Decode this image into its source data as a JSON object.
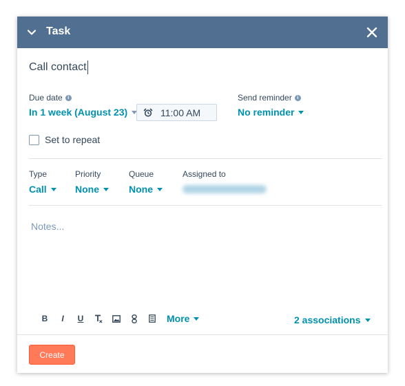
{
  "header": {
    "title": "Task",
    "collapse_icon": "chevron-down-icon",
    "close_icon": "close-icon"
  },
  "task": {
    "title_value": "Call contact"
  },
  "due_date": {
    "label": "Due date",
    "value": "In 1 week (August 23)",
    "time": "11:00 AM",
    "time_icon": "alarm-clock-icon"
  },
  "reminder": {
    "label": "Send reminder",
    "value": "No reminder"
  },
  "repeat": {
    "label": "Set to repeat",
    "checked": false
  },
  "fields": {
    "type": {
      "label": "Type",
      "value": "Call"
    },
    "priority": {
      "label": "Priority",
      "value": "None"
    },
    "queue": {
      "label": "Queue",
      "value": "None"
    },
    "assigned": {
      "label": "Assigned to"
    }
  },
  "notes": {
    "placeholder": "Notes..."
  },
  "toolbar": {
    "bold": "B",
    "italic": "I",
    "underline": "U",
    "clear_format": "T",
    "more_label": "More"
  },
  "associations": {
    "label": "2 associations"
  },
  "footer": {
    "create_label": "Create"
  },
  "colors": {
    "header_bg": "#516f90",
    "link": "#0091ae",
    "primary_button": "#ff7a59",
    "text": "#33475b"
  }
}
